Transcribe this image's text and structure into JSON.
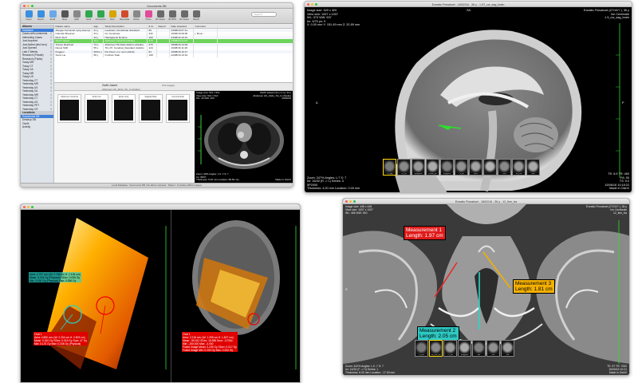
{
  "colors": {
    "accent": "#3d7fd9",
    "selected_row": "#6dd35a",
    "measure_red": "#e01a1a",
    "measure_yellow": "#f3b000",
    "measure_cyan": "#2ec9c3"
  },
  "w1": {
    "title": "Documents DB",
    "search_placeholder": "Search",
    "toolbar": [
      {
        "label": "Import",
        "icon": "import-icon",
        "color": "#3a8fe0"
      },
      {
        "label": "Export",
        "icon": "export-icon",
        "color": "#3a8fe0"
      },
      {
        "label": "Email",
        "icon": "mail-icon",
        "color": "#6aa8e8"
      },
      {
        "label": "Meta",
        "icon": "meta-icon",
        "color": "#555"
      },
      {
        "label": "Q&R",
        "icon": "query-icon",
        "color": "#888"
      },
      {
        "label": "Send",
        "icon": "send-icon",
        "color": "#2fa84f"
      },
      {
        "label": "Anonymize",
        "icon": "anonymize-icon",
        "color": "#2fa84f"
      },
      {
        "label": "Burn",
        "icon": "burn-icon",
        "color": "#d7a500"
      },
      {
        "label": "Meta-Data",
        "icon": "metadata-icon",
        "color": "#d14b2b"
      },
      {
        "label": "Delete",
        "icon": "trash-icon",
        "color": "#888"
      },
      {
        "label": "Photo",
        "icon": "photo-icon",
        "color": "#e24a9b"
      },
      {
        "label": "2D Viewer",
        "icon": "viewer2d-icon",
        "color": "#6b6b6b"
      },
      {
        "label": "3D MPR",
        "icon": "mpr-icon",
        "color": "#6b6b6b"
      },
      {
        "label": "4D Viewer",
        "icon": "viewer4d-icon",
        "color": "#6b6b6b"
      },
      {
        "label": "Report",
        "icon": "report-icon",
        "color": "#6b6b6b"
      }
    ],
    "sidebar_head": "Albums",
    "sidebar": [
      {
        "label": "Database",
        "count": ""
      },
      {
        "label": "Cases with comments",
        "count": "0"
      },
      {
        "label": "Interesting Cases",
        "count": "0"
      },
      {
        "label": "Just Acquired",
        "count": "0"
      },
      {
        "label": "Just Added (last hour)",
        "count": "0"
      },
      {
        "label": "Just Opened",
        "count": "0"
      },
      {
        "label": "Last 2 Weeks",
        "count": "0"
      },
      {
        "label": "Research (Private)",
        "count": "0"
      },
      {
        "label": "Research (Public)",
        "count": "0"
      },
      {
        "label": "Today MR",
        "count": "0"
      },
      {
        "label": "Today CT",
        "count": "0"
      },
      {
        "label": "Today XA",
        "count": "0"
      },
      {
        "label": "Today MR",
        "count": "0"
      },
      {
        "label": "Today US",
        "count": "0"
      },
      {
        "label": "Yesterday CT",
        "count": "0"
      },
      {
        "label": "Yesterday MR",
        "count": "0"
      },
      {
        "label": "Yesterday US",
        "count": "0"
      },
      {
        "label": "Yesterday XA",
        "count": "0"
      },
      {
        "label": "Yesterday MR",
        "count": "0"
      },
      {
        "label": "Yesterday CT",
        "count": "0"
      },
      {
        "label": "Yesterday US",
        "count": "0"
      },
      {
        "label": "Yesterday PET",
        "count": "0"
      },
      {
        "label": "Yesterday CR",
        "count": "0"
      }
    ],
    "locations_head": "Locations",
    "locations": [
      "Documents DB",
      "Desktop DB",
      "OsiriX",
      "Activity"
    ],
    "columns": [
      "Patient name",
      "Age",
      "Study Description",
      "# im",
      "Report",
      "Date Acquired",
      "Comment"
    ],
    "rows": [
      [
        "Abegeu Fernando Lyloy Asemyt",
        "41 y",
        "Landstern (Vertebrale Standard",
        "60",
        "",
        "23/08/16 07:11",
        ""
      ],
      [
        "Calendo Brauced",
        "23 y",
        "Irm Cerebrale",
        "332",
        "",
        "15/06/16 08:06",
        "j. Bouc..."
      ],
      [
        "Muzz Dorf",
        "43 y",
        "Handgelenk Routine",
        "100",
        "",
        "23/08/16 10:12",
        ""
      ],
      [
        "Zarith Jawed",
        "44 y",
        "Abdomen Cerebral (Adulte)",
        "373",
        "",
        "23/08/16 11:03",
        ""
      ],
      [
        "Trance Reinhold",
        "74 y",
        "Abdomen HK Abdo Abdom (Adults)",
        "275",
        "",
        "18/08/16 14:03",
        ""
      ],
      [
        "Diesel Shift",
        "55 y",
        "Thx-07, Cerebral_Standard (Adults)",
        "124",
        "",
        "16/08/16 11:48",
        ""
      ],
      [
        "Fluggen",
        "60/14 y",
        "Pet Fluori, mu. Ipun (Adult)",
        "81",
        "",
        "15/08/16 10:17",
        ""
      ],
      [
        "Sonic Lie",
        "58 y",
        "Ct Abdo Total",
        "108",
        "",
        "22/08/16 10:16",
        ""
      ]
    ],
    "split_left": "Zarith Jawed",
    "split_left_sub": "Abdomen HK_Abdo_Tot_In (Adulte)",
    "split_right": "373 images",
    "thumbs": [
      {
        "label": "Abdomen Cerebral"
      },
      {
        "label": "Abdo Cal"
      },
      {
        "label": "Abdo Corp"
      },
      {
        "label": "Sagittal Abdo"
      },
      {
        "label": "Coronal Abdo"
      }
    ],
    "preview_tl": [
      "Image size: 512 x 512",
      "View size: 512 x 512",
      "WL: 40 WW: 400"
    ],
    "preview_tr": [
      "Zarith Jawed (44 y 2 m), 44 y",
      "Abdomen HK_Abdo_Tot_In (Adulte)",
      "23/08/16"
    ],
    "preview_bl": [
      "Zoom: 90% Angles: L:0 -7 S: 7",
      "Im: 35/57",
      "Thickness: 5.00 mm Location: 88.83 mm"
    ],
    "preview_br": [
      "Made in OsiriX"
    ],
    "status": "Local Database : Documents DB | No album selected : Patient : 9 studies (3944 images)"
  },
  "w2": {
    "title": "Exeatto Finnaboel - 18/02/16 - 36 y - 1.5T_cw_sag_brain",
    "tl": [
      "Image size: 320 x 320",
      "View size: 1007 x 1007",
      "WL: 373 WW: 537",
      "Im: 9/75 pn: 9",
      "X: 0.00 mm Y: 151.49 mm Z: 32.89 mm"
    ],
    "tr": [
      "Exeatto Finnaboel (27/10/? ), 36 y",
      "Irm Cerebrale",
      "1.5_cw_sag_brain"
    ],
    "bl": [
      "Zoom: 247% Angles: L:7 S: 7",
      "Im: 16/30 (R -> L) Series: 3",
      "5P2000",
      "Thickness: 4.00 mm Location: 0.00 mm"
    ],
    "br": [
      "TE: 8.9 TR: 460",
      "FA: 90",
      "TS: 5.0",
      "15/06/16 10:18:22",
      "Made in OsiriX"
    ],
    "top_marker": "SA",
    "left_marker": "A",
    "right_marker": "P",
    "strip": [
      "T1_sag",
      "T2_cor",
      "polygone",
      "FLAIR_ax",
      "polygone",
      "T2_ax",
      "MPR",
      "",
      "DWI",
      "12_fine",
      "SWI"
    ]
  },
  "w3": {
    "left_title": "",
    "right_title": "",
    "roi_cyan_lines": [
      "Area: 4.797 cm² (W: 2.782 cm H: 2.106 cm)",
      "Mean: 0.194 Gy (Physical) SDev: 0.096 Gy",
      "Min: 0.000 Gy (Physical) Max: 0.356 Gy"
    ],
    "roi_red_title": "Oval 1",
    "roi_red_left_lines": [
      "Area: 4.850 cm² (W: 2.204 cm H: 2.803 cm)",
      "Mean: 0.010 Gy SDev: 0.019 Gy Sum: 47 Gy",
      "Min: 0.137 Gy Max: 0.336 Gy (Physical)"
    ],
    "roi_red_right_title": "Oval 1",
    "roi_red_right_lines": [
      "Area: 2.216 cm² (W: 1.295 cm H: 1.827 cm)",
      "Mean: -95.512 SDev: 15.585 Sum: -12'064",
      "Min: -150.000 Max: -4.000",
      "Fused Image Mean: 0.239 Gy SDev: 0.017 Gy",
      "Fused Image Min: 0.200 Gy Max: 0.254 Gy"
    ]
  },
  "w4": {
    "title": "Exeatto Finnaboel - 18/02/16 - 36 y - 12_fine_tra",
    "tl": [
      "Image size: 448 x 448",
      "View size: 1007 x 1007",
      "WL: 466 WW: 940"
    ],
    "tr": [
      "Exeatto Finnaboel (27/10/? ), 36 y",
      "Irm Cerebrale",
      "12_fine_tra"
    ],
    "bl": [
      "Zoom: 442% Angles: L:0 -7 S: 7",
      "Im: 14/25 (F -> H) Series: 1",
      "Thickness: 6.00 mm Location: -17.63 mm"
    ],
    "br": [
      "TE: 97 TR: 7000",
      "15/06/16 10:21",
      "Made in OsiriX"
    ],
    "m1_title": "Measurement 1",
    "m1_len": "Length: 1.97 cm",
    "m2_title": "Measurement 2",
    "m2_len": "Length: 2.05 cm",
    "m3_title": "Measurement 3",
    "m3_len": "Length: 1.81 cm",
    "left_marker": "R",
    "strip": [
      "t1_tse",
      "12_fine_tra",
      "T2_tra",
      "polygone",
      "flair",
      "dwi",
      "swi"
    ]
  }
}
